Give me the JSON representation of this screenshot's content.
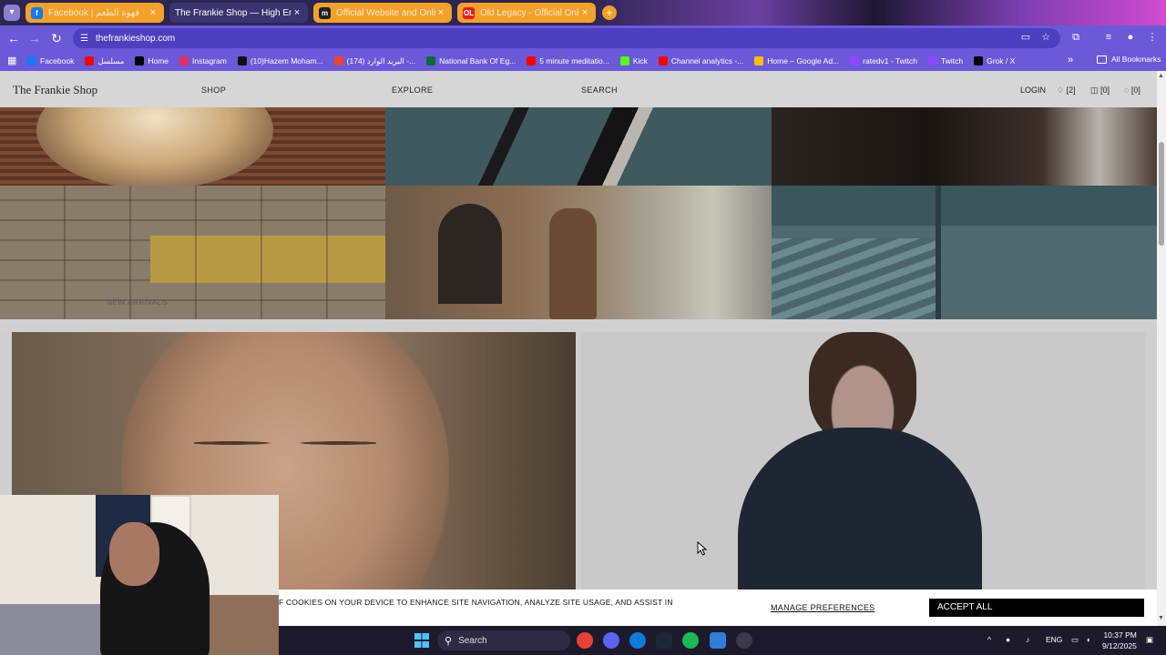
{
  "browser": {
    "tabs": [
      {
        "title": "Facebook | قهوة الطعم",
        "favicon": "f",
        "favicon_color": "#1877f2"
      },
      {
        "title": "The Frankie Shop — High End Fashion",
        "favicon": "",
        "favicon_color": "#3a3470"
      },
      {
        "title": "Official Website and Online Store",
        "favicon": "m",
        "favicon_color": "#222222"
      },
      {
        "title": "Old Legacy - Official Online Store",
        "favicon": "OL",
        "favicon_color": "#e02020"
      }
    ],
    "url": "thefrankieshop.com",
    "bookmarks": [
      {
        "label": "Facebook",
        "color": "#1877f2"
      },
      {
        "label": "مسلسل",
        "color": "#ff0000"
      },
      {
        "label": "Home",
        "color": "#000000"
      },
      {
        "label": "Instagram",
        "color": "#e1306c"
      },
      {
        "label": "(10)Hazem Moham...",
        "color": "#111111"
      },
      {
        "label": "(174) البريد الوارد -...",
        "color": "#ea4335"
      },
      {
        "label": "National Bank Of Eg...",
        "color": "#0b6b3a"
      },
      {
        "label": "5 minute meditatio...",
        "color": "#ff0000"
      },
      {
        "label": "Kick",
        "color": "#53fc18"
      },
      {
        "label": "Channel analytics -...",
        "color": "#ff0000"
      },
      {
        "label": "Home – Google Ad...",
        "color": "#fbbc04"
      },
      {
        "label": "ratedv1 - Twitch",
        "color": "#9146ff"
      },
      {
        "label": "Twitch",
        "color": "#9146ff"
      },
      {
        "label": "Grok / X",
        "color": "#000000"
      }
    ],
    "all_bookmarks": "All Bookmarks"
  },
  "site": {
    "logo": "The Frankie Shop",
    "nav": {
      "shop": "SHOP",
      "explore": "EXPLORE",
      "search": "SEARCH"
    },
    "header_right": {
      "login": "LOGIN",
      "wishlist": "[2]",
      "bag_saved": "[0]",
      "cart": "[0]"
    },
    "new_arrivals": "NEW ARRIVALS",
    "cookie": {
      "text": "F COOKIES ON YOUR DEVICE TO ENHANCE SITE NAVIGATION, ANALYZE SITE USAGE, AND ASSIST IN",
      "manage": "MANAGE PREFERENCES",
      "accept": "ACCEPT ALL"
    }
  },
  "taskbar": {
    "search": "Search",
    "lang": "ENG",
    "time": "10:37 PM",
    "date": "9/12/2025"
  }
}
